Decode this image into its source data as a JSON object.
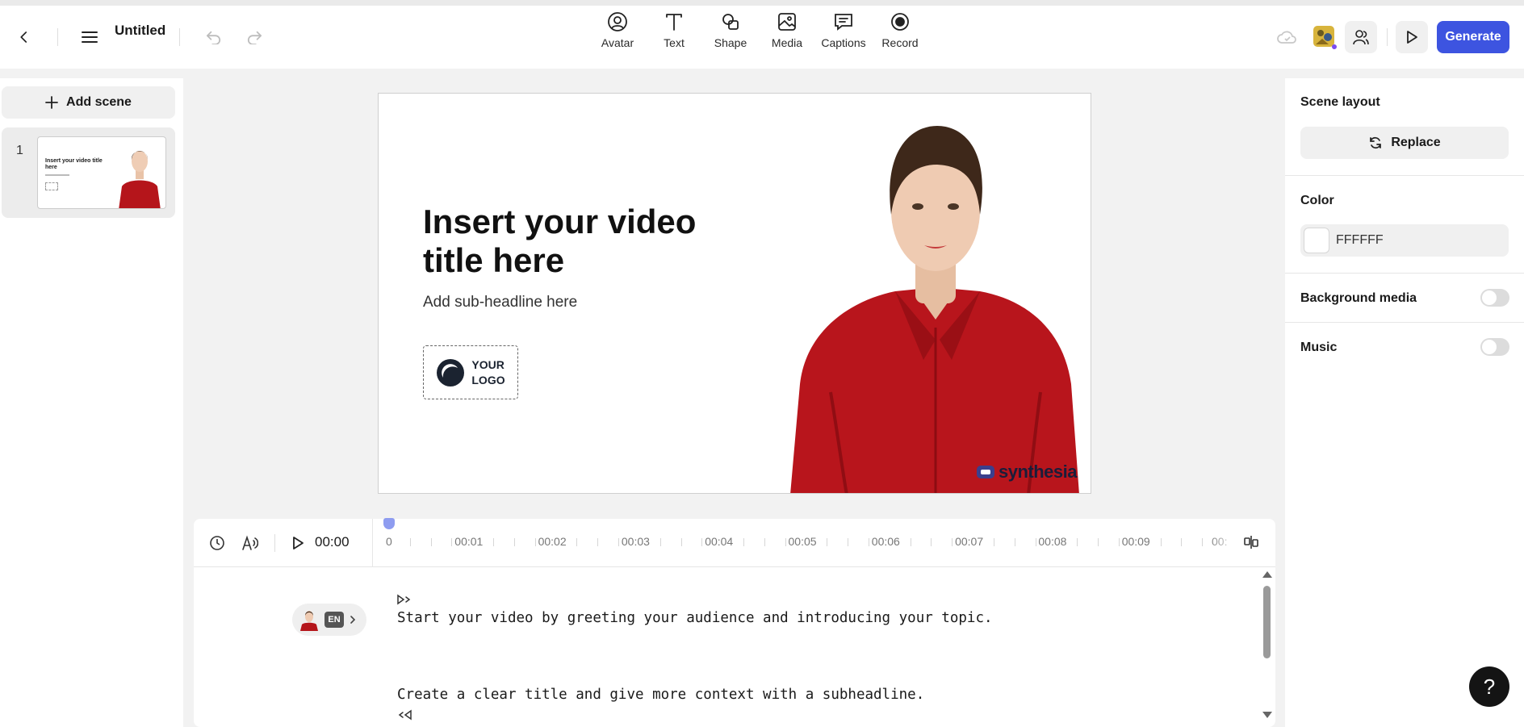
{
  "header": {
    "title": "Untitled",
    "tools": [
      {
        "label": "Avatar",
        "icon": "avatar-icon"
      },
      {
        "label": "Text",
        "icon": "text-icon"
      },
      {
        "label": "Shape",
        "icon": "shape-icon"
      },
      {
        "label": "Media",
        "icon": "media-icon"
      },
      {
        "label": "Captions",
        "icon": "captions-icon"
      },
      {
        "label": "Record",
        "icon": "record-icon"
      }
    ],
    "generate_label": "Generate",
    "accent": "#3d54e0"
  },
  "sidebar": {
    "add_scene_label": "Add scene",
    "scenes": [
      {
        "number": "1"
      }
    ]
  },
  "canvas": {
    "title": "Insert your video title here",
    "subheadline": "Add sub-headline here",
    "logo_text_line1": "YOUR",
    "logo_text_line2": "LOGO",
    "watermark": "synthesia",
    "background_color": "#ffffff"
  },
  "timeline": {
    "current_time": "00:00",
    "ticks": [
      "0",
      "00:01",
      "00:02",
      "00:03",
      "00:04",
      "00:05",
      "00:06",
      "00:07",
      "00:08",
      "00:09",
      "00:"
    ],
    "voice_language": "EN",
    "script_lines": [
      "Start your video by greeting your audience and introducing your topic.",
      "Create a clear title and give more context with a subheadline."
    ]
  },
  "properties": {
    "scene_layout_label": "Scene layout",
    "replace_label": "Replace",
    "color_label": "Color",
    "color_value": "FFFFFF",
    "background_media_label": "Background media",
    "background_media_on": false,
    "music_label": "Music",
    "music_on": false
  },
  "help_label": "?"
}
